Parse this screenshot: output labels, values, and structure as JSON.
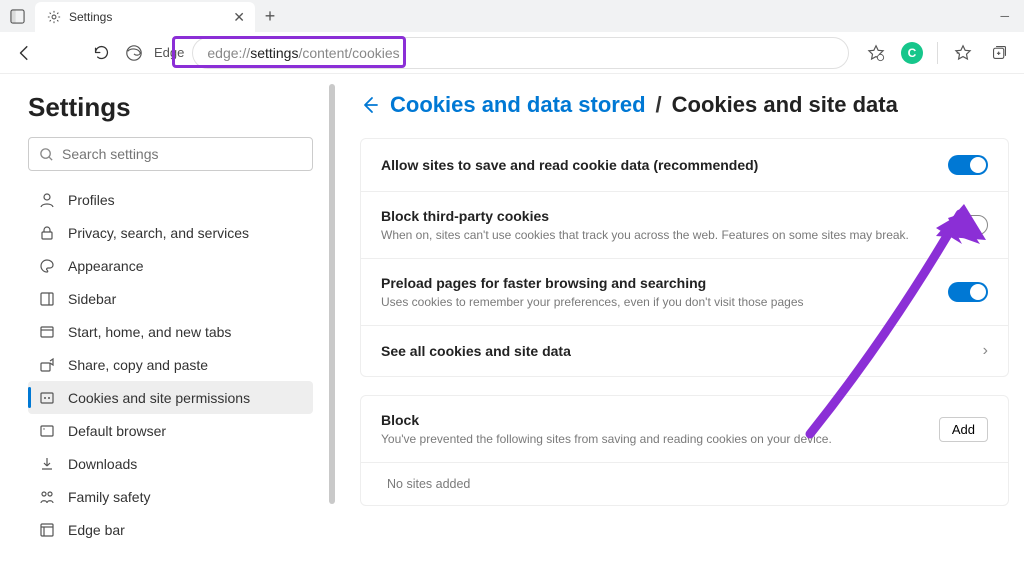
{
  "window": {
    "tab_title": "Settings"
  },
  "toolbar": {
    "edge_label": "Edge",
    "url_prefix": "edge://",
    "url_bold": "settings",
    "url_suffix": "/content/cookies"
  },
  "sidebar": {
    "title": "Settings",
    "search_placeholder": "Search settings",
    "items": [
      {
        "label": "Profiles",
        "icon": "profile-icon"
      },
      {
        "label": "Privacy, search, and services",
        "icon": "lock-icon"
      },
      {
        "label": "Appearance",
        "icon": "palette-icon"
      },
      {
        "label": "Sidebar",
        "icon": "sidebar-icon"
      },
      {
        "label": "Start, home, and new tabs",
        "icon": "tab-icon"
      },
      {
        "label": "Share, copy and paste",
        "icon": "share-icon"
      },
      {
        "label": "Cookies and site permissions",
        "icon": "cookie-icon"
      },
      {
        "label": "Default browser",
        "icon": "browser-icon"
      },
      {
        "label": "Downloads",
        "icon": "download-icon"
      },
      {
        "label": "Family safety",
        "icon": "family-icon"
      },
      {
        "label": "Edge bar",
        "icon": "edgebar-icon"
      }
    ],
    "active_index": 6
  },
  "content": {
    "breadcrumb_link": "Cookies and data stored",
    "breadcrumb_sep": "/",
    "breadcrumb_current": "Cookies and site data",
    "rows": {
      "allow": {
        "title": "Allow sites to save and read cookie data (recommended)",
        "on": true
      },
      "block_third": {
        "title": "Block third-party cookies",
        "sub": "When on, sites can't use cookies that track you across the web. Features on some sites may break.",
        "on": false
      },
      "preload": {
        "title": "Preload pages for faster browsing and searching",
        "sub": "Uses cookies to remember your preferences, even if you don't visit those pages",
        "on": true
      },
      "see_all": {
        "title": "See all cookies and site data"
      }
    },
    "block_section": {
      "title": "Block",
      "sub": "You've prevented the following sites from saving and reading cookies on your device.",
      "add_label": "Add",
      "empty": "No sites added"
    }
  },
  "annotation": {
    "arrow_color": "#8b2fd6"
  }
}
